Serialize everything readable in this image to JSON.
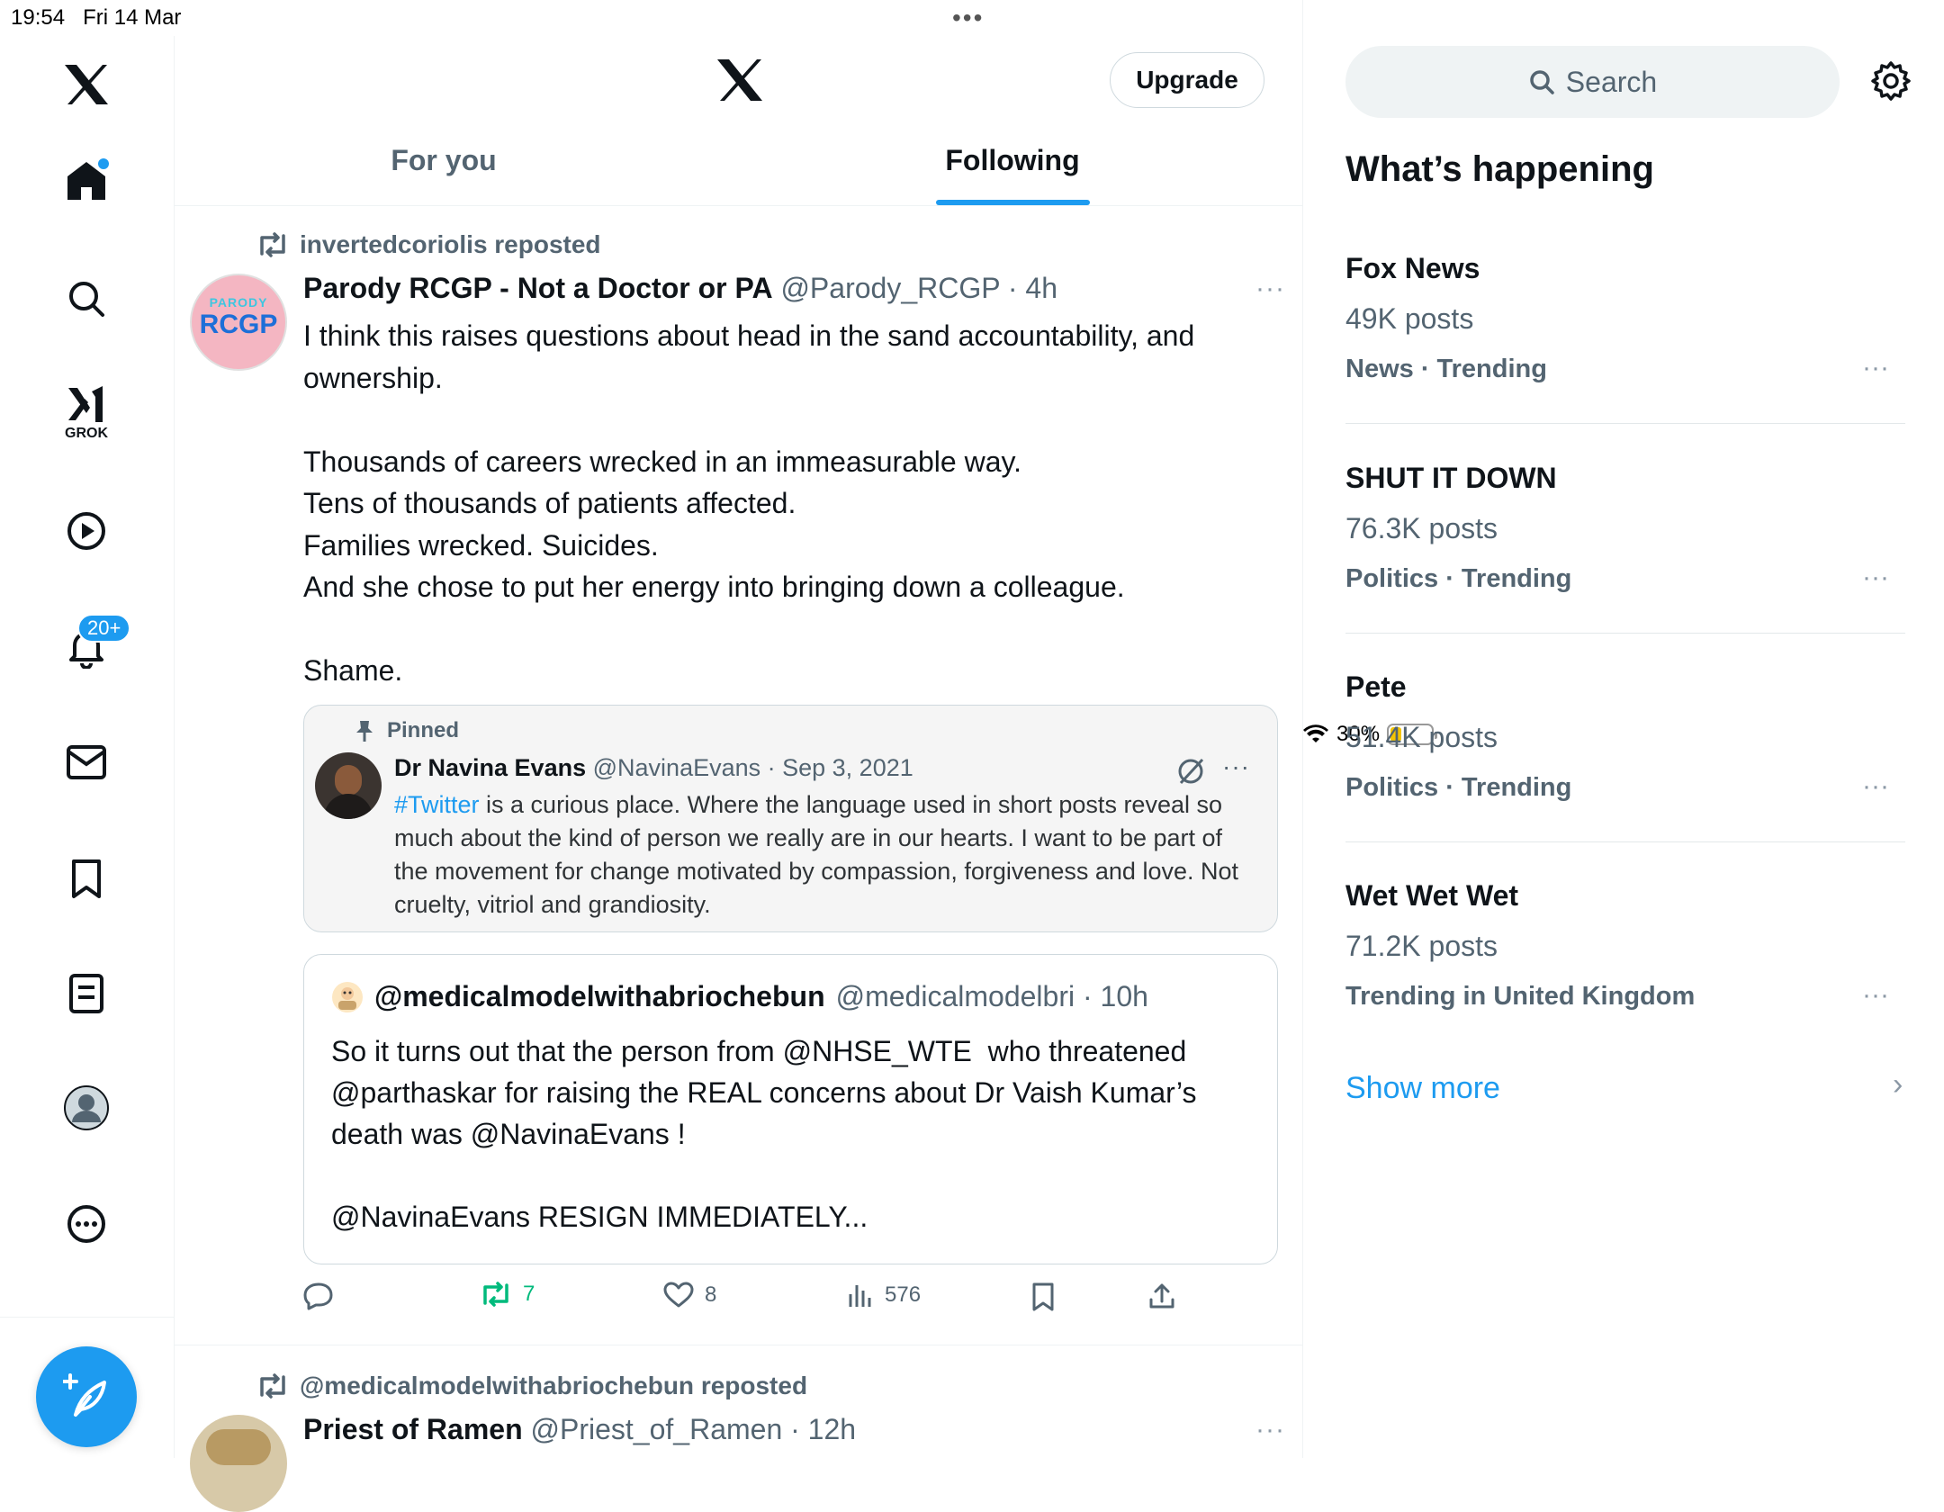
{
  "status": {
    "time": "19:54",
    "date": "Fri 14 Mar",
    "battery": "30%",
    "battery_level": 0.3
  },
  "nav": {
    "grok_label": "GROK",
    "notifications_badge": "20+"
  },
  "header": {
    "upgrade_label": "Upgrade",
    "tabs": [
      {
        "label": "For you",
        "active": false
      },
      {
        "label": "Following",
        "active": true
      }
    ]
  },
  "post1": {
    "repost_by": "invertedcoriolis reposted",
    "avatar_top": "PARODY",
    "avatar_main": "RCGP",
    "name": "Parody RCGP - Not a Doctor or PA",
    "handle": "@Parody_RCGP",
    "time": "4h",
    "text": "I think this raises questions about head in the sand accountability, and ownership.\n\nThousands of careers wrecked in an immeasurable way.\nTens of thousands of patients affected.\nFamilies wrecked. Suicides.\nAnd she chose to put her energy into bringing down a colleague.\n\nShame.",
    "pinned_quote": {
      "pinned_label": "Pinned",
      "name": "Dr Navina Evans",
      "handle": "@NavinaEvans",
      "date": "Sep 3, 2021",
      "hashtag": "#Twitter",
      "text": " is a curious place. Where the language used in short posts reveal so much about the kind of person we really are in our hearts. I want to be part of the movement for change motivated by compassion, forgiveness and love. Not cruelty, vitriol and grandiosity."
    },
    "quote": {
      "name": "@medicalmodelwithabriochebun",
      "handle": "@medicalmodelbri",
      "time": "10h",
      "text": "So it turns out that the person from @NHSE_WTE  who threatened @parthaskar for raising the REAL concerns about Dr Vaish Kumar’s death was @NavinaEvans !\n\n@NavinaEvans RESIGN IMMEDIATELY..."
    },
    "actions": {
      "reposts": "7",
      "likes": "8",
      "views": "576"
    }
  },
  "post2": {
    "repost_by": "@medicalmodelwithabriochebun reposted",
    "name": "Priest of Ramen",
    "handle": "@Priest_of_Ramen",
    "time": "12h"
  },
  "sidebar": {
    "search_placeholder": "Search",
    "heading": "What’s happening",
    "trends": [
      {
        "title": "Fox News",
        "posts": "49K posts",
        "category": "News · Trending"
      },
      {
        "title": "SHUT IT DOWN",
        "posts": "76.3K posts",
        "category": "Politics · Trending"
      },
      {
        "title": "Pete",
        "posts": "51.4K posts",
        "category": "Politics · Trending"
      },
      {
        "title": "Wet Wet Wet",
        "posts": "71.2K posts",
        "category": "Trending in United Kingdom"
      }
    ],
    "show_more": "Show more"
  },
  "colors": {
    "accent": "#1d9bf0",
    "repost_green": "#00ba7c",
    "text_primary": "#0f1419",
    "text_secondary": "#536471"
  }
}
